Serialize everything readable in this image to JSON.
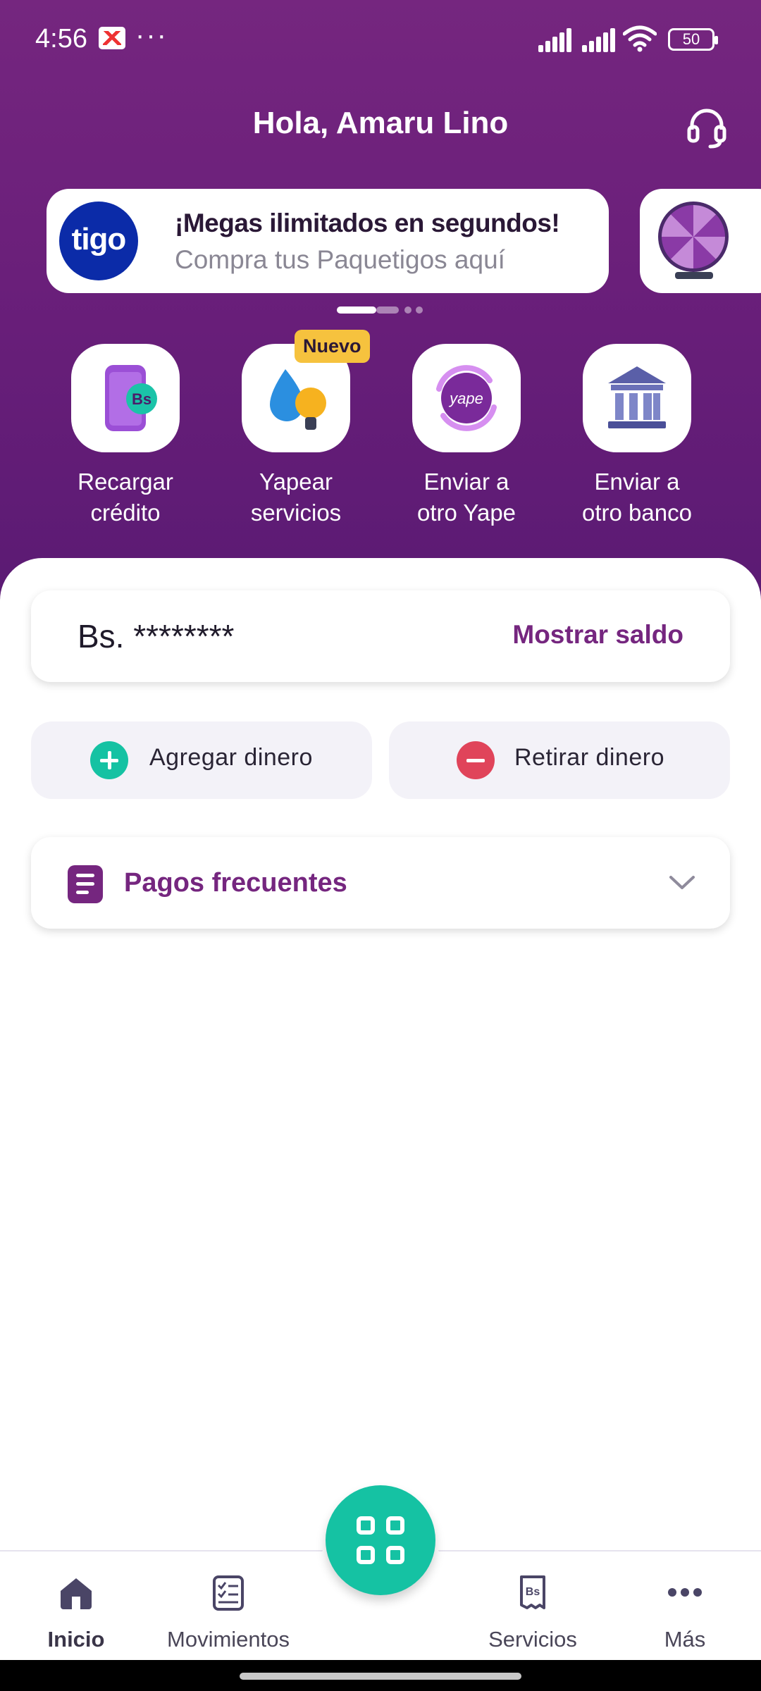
{
  "status_bar": {
    "time": "4:56",
    "more": "···",
    "battery": "50"
  },
  "header": {
    "greeting": "Hola, Amaru Lino"
  },
  "banner": {
    "logo": "tigo",
    "title": "¡Megas ilimitados en segundos!",
    "subtitle": "Compra tus Paquetigos aquí"
  },
  "quick_actions": [
    {
      "line1": "Recargar",
      "line2": "crédito",
      "icon": "phone-bs-icon"
    },
    {
      "line1": "Yapear",
      "line2": "servicios",
      "icon": "water-bulb-icon",
      "badge": "Nuevo"
    },
    {
      "line1": "Enviar a",
      "line2": "otro Yape",
      "icon": "yape-transfer-icon"
    },
    {
      "line1": "Enviar a",
      "line2": "otro banco",
      "icon": "bank-icon"
    }
  ],
  "balance": {
    "amount": "Bs. ********",
    "show_label": "Mostrar saldo"
  },
  "money": {
    "add_label": "Agregar dinero",
    "withdraw_label": "Retirar dinero"
  },
  "frequent": {
    "label": "Pagos frecuentes"
  },
  "nav": [
    {
      "label": "Inicio"
    },
    {
      "label": "Movimientos"
    },
    {
      "label": "Servicios"
    },
    {
      "label": "Más"
    }
  ],
  "colors": {
    "brand_purple": "#75267f",
    "teal": "#15c2a3",
    "red": "#e0445a",
    "badge_yellow": "#f6c23e",
    "tigo_blue": "#0b2ba8"
  }
}
